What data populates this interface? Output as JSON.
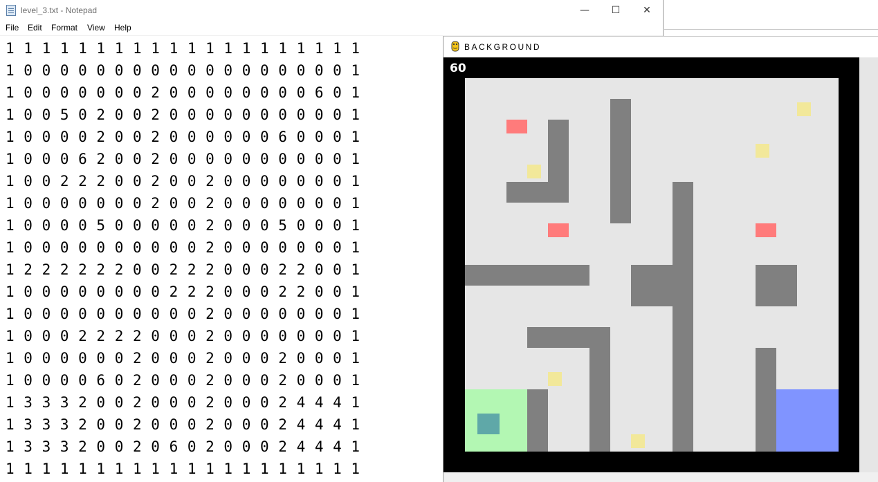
{
  "notepad": {
    "title": "level_3.txt - Notepad",
    "controls": {
      "minimize": "—",
      "maximize": "☐",
      "close": "✕"
    },
    "menu": [
      "File",
      "Edit",
      "Format",
      "View",
      "Help"
    ],
    "lines": [
      "1 1 1 1 1 1 1 1 1 1 1 1 1 1 1 1 1 1 1 1",
      "1 0 0 0 0 0 0 0 0 0 0 0 0 0 0 0 0 0 0 1",
      "1 0 0 0 0 0 0 0 2 0 0 0 0 0 0 0 0 6 0 1",
      "1 0 0 5 0 2 0 0 2 0 0 0 0 0 0 0 0 0 0 1",
      "1 0 0 0 0 2 0 0 2 0 0 0 0 0 0 6 0 0 0 1",
      "1 0 0 0 6 2 0 0 2 0 0 0 0 0 0 0 0 0 0 1",
      "1 0 0 2 2 2 0 0 2 0 0 2 0 0 0 0 0 0 0 1",
      "1 0 0 0 0 0 0 0 2 0 0 2 0 0 0 0 0 0 0 1",
      "1 0 0 0 0 5 0 0 0 0 0 2 0 0 0 5 0 0 0 1",
      "1 0 0 0 0 0 0 0 0 0 0 2 0 0 0 0 0 0 0 1",
      "1 2 2 2 2 2 2 0 0 2 2 2 0 0 0 2 2 0 0 1",
      "1 0 0 0 0 0 0 0 0 2 2 2 0 0 0 2 2 0 0 1",
      "1 0 0 0 0 0 0 0 0 0 0 2 0 0 0 0 0 0 0 1",
      "1 0 0 0 2 2 2 2 0 0 0 2 0 0 0 0 0 0 0 1",
      "1 0 0 0 0 0 0 2 0 0 0 2 0 0 0 2 0 0 0 1",
      "1 0 0 0 0 6 0 2 0 0 0 2 0 0 0 2 0 0 0 1",
      "1 3 3 3 2 0 0 2 0 0 0 2 0 0 0 2 4 4 4 1",
      "1 3 3 3 2 0 0 2 0 0 0 2 0 0 0 2 4 4 4 1",
      "1 3 3 3 2 0 0 2 0 6 0 2 0 0 0 2 4 4 4 1",
      "1 1 1 1 1 1 1 1 1 1 1 1 1 1 1 1 1 1 1 1"
    ]
  },
  "game": {
    "title": "BACKGROUND",
    "fps": "60",
    "colors": {
      "border": "#000000",
      "floor": "#e6e6e6",
      "wall": "#808080",
      "enemy": "#ff7b7b",
      "coin": "#f2e89a",
      "start": "#b3f7b3",
      "goal": "#8094ff",
      "player": "#5fa8a8"
    }
  }
}
